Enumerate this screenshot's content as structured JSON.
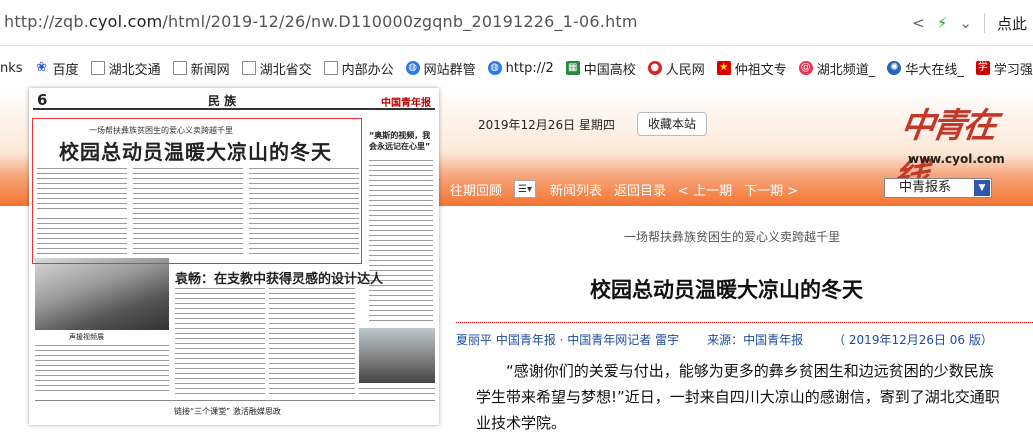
{
  "browser": {
    "url_prefix": "http://zqb.",
    "url_host": "cyol.com",
    "url_path": "/html/2019-12/26/nw.D110000zgqnb_20191226_1-06.htm",
    "right_text": "点此"
  },
  "bookmarks": [
    {
      "label": "nks",
      "icon": "none"
    },
    {
      "label": "百度",
      "icon": "baidu-paw-icon"
    },
    {
      "label": "湖北交通",
      "icon": "page-icon"
    },
    {
      "label": "新闻网",
      "icon": "page-icon"
    },
    {
      "label": "湖北省交",
      "icon": "page-icon"
    },
    {
      "label": "内部办公",
      "icon": "page-icon"
    },
    {
      "label": "网站群管",
      "icon": "globe-icon"
    },
    {
      "label": "http://2",
      "icon": "globe-icon"
    },
    {
      "label": "中国高校",
      "icon": "green-square-icon"
    },
    {
      "label": "人民网",
      "icon": "red-circle-icon"
    },
    {
      "label": "仲祖文专",
      "icon": "party-flag-icon"
    },
    {
      "label": "湖北频道_",
      "icon": "swirl-icon"
    },
    {
      "label": "华大在线_",
      "icon": "gear-icon"
    },
    {
      "label": "学习强国",
      "icon": "red-square-icon"
    }
  ],
  "thumbnail": {
    "page_number": "6",
    "section": "民 族",
    "masthead": "中国青年报",
    "kicker": "一场帮扶彝族贫困生的爱心义卖跨越千里",
    "headline": "校园总动员温暖大凉山的冬天",
    "side_quote": "“奥斯的视频，我会永远记在心里”",
    "second_headline": "袁畅：在支教中获得灵感的设计达人",
    "photo_caption": "声援视频展",
    "box_title": "链接“三个课堂” 激活融媒思政"
  },
  "header": {
    "date": "2019年12月26日  星期四",
    "favorite_button": "收藏本站",
    "brand_cn": "中青在线",
    "brand_en": "www.cyol.com"
  },
  "nav": {
    "archive": "往期回顾",
    "news_list": "新闻列表",
    "back": "返回目录",
    "prev": "< 上一期",
    "next": "下一期 >",
    "paper_select": "中青报系"
  },
  "article": {
    "subtitle": "一场帮扶彝族贫困生的爱心义卖跨越千里",
    "title": "校园总动员温暖大凉山的冬天",
    "authors": "夏丽平  中国青年报 · 中国青年网记者  雷宇",
    "source": "来源：中国青年报",
    "date_edition": "（  2019年12月26日    06  版）",
    "body": "“感谢你们的关爱与付出，能够为更多的彝乡贫困生和边远贫困的少数民族学生带来希望与梦想!”近日，一封来自四川大凉山的感谢信，寄到了湖北交通职业技术学院。"
  },
  "colors": {
    "accent": "#f47432",
    "link": "#1f4da3",
    "highlight": "#e33333"
  }
}
